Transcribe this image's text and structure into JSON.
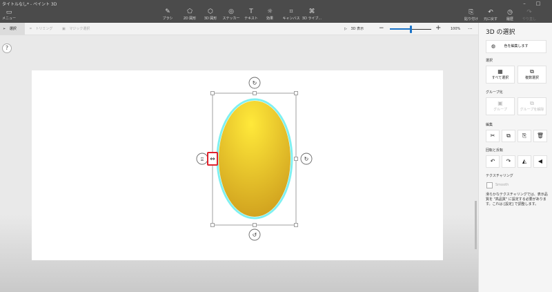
{
  "window": {
    "title": "タイトルなし* - ペイント 3D",
    "controls": [
      "–",
      "□"
    ]
  },
  "menu": {
    "label": "メニュー"
  },
  "toolbar": {
    "tools": [
      {
        "label": "ブラシ",
        "icon": "brush-icon",
        "glyph": "✎"
      },
      {
        "label": "2D 図形",
        "icon": "2d-shapes-icon",
        "glyph": "⬠"
      },
      {
        "label": "3D 図形",
        "icon": "3d-shapes-icon",
        "glyph": "⬡"
      },
      {
        "label": "ステッカー",
        "icon": "sticker-icon",
        "glyph": "◎"
      },
      {
        "label": "テキスト",
        "icon": "text-icon",
        "glyph": "T"
      },
      {
        "label": "効果",
        "icon": "effects-icon",
        "glyph": "☼"
      },
      {
        "label": "キャンバス",
        "icon": "canvas-icon",
        "glyph": "⌗"
      },
      {
        "label": "3D ライブ...",
        "icon": "3d-library-icon",
        "glyph": "⌘"
      }
    ],
    "right": [
      {
        "label": "貼り付け",
        "icon": "paste-icon",
        "glyph": "⎘"
      },
      {
        "label": "元に戻す",
        "icon": "undo-icon",
        "glyph": "↶"
      },
      {
        "label": "履歴",
        "icon": "history-icon",
        "glyph": "◷"
      },
      {
        "label": "やり直し",
        "icon": "redo-icon",
        "glyph": "↷"
      }
    ]
  },
  "subbar": {
    "select": "選択",
    "crop": "トリミング",
    "magic_select": "マジック選択",
    "view3d": "3D 表示",
    "zoom_percent": "100%",
    "zoom_level": 0.5,
    "more": "···"
  },
  "help": "?",
  "colors": {
    "egg_top": "#ffe93a",
    "egg_bottom": "#c9961a",
    "outline": "#7ff0f0",
    "accent": "#1a73c8"
  },
  "panel": {
    "title": "3D の選択",
    "edit_color": "色を編集します",
    "select_header": "選択",
    "select_all": "すべて選択",
    "multi_select": "複数選択",
    "group_header": "グループ化",
    "group": "グループ",
    "ungroup": "グループを解除",
    "edit_header": "編集",
    "rotate_header": "回転と反転",
    "texture_header": "テクスチャリング",
    "smooth": "Smooth",
    "note": "滑らかなテクスチャリングでは、表示品質を \"高品質\" に設定する必要があります。これは [設定] で調整します。"
  }
}
